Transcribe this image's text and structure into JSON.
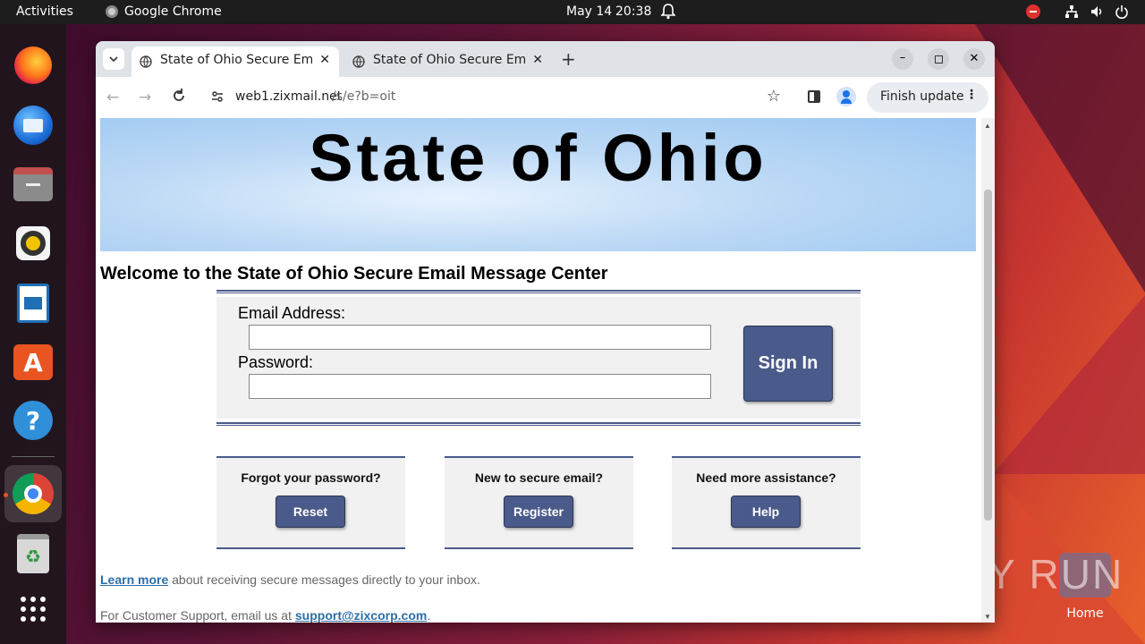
{
  "topbar": {
    "activities": "Activities",
    "app_name": "Google Chrome",
    "date": "May 14",
    "time": "20:38"
  },
  "dock": {
    "items": [
      "firefox-icon",
      "thunderbird-icon",
      "files-icon",
      "rhythmbox-icon",
      "libreoffice-writer-icon",
      "app-center-icon",
      "help-icon",
      "chrome-icon",
      "trash-icon",
      "show-apps-icon"
    ]
  },
  "desktop": {
    "home_label": "Home",
    "watermark": "ANY RUN"
  },
  "browser": {
    "tabs": [
      {
        "title": "State of Ohio Secure Em"
      },
      {
        "title": "State of Ohio Secure Em"
      }
    ],
    "url_host": "web1.zixmail.net",
    "url_path": "/s/e?b=oit",
    "finish_update": "Finish update"
  },
  "page": {
    "banner_title": "State of Ohio",
    "heading": "Welcome to the State of Ohio Secure Email Message Center",
    "email_label": "Email Address:",
    "email_value": "",
    "password_label": "Password:",
    "password_value": "",
    "sign_in": "Sign In",
    "boxes": [
      {
        "question": "Forgot your password?",
        "button": "Reset"
      },
      {
        "question": "New to secure email?",
        "button": "Register"
      },
      {
        "question": "Need more assistance?",
        "button": "Help"
      }
    ],
    "learn_more_link": "Learn more",
    "learn_more_text": " about receiving secure messages directly to your inbox.",
    "support_text": "For Customer Support, email us at ",
    "support_link": "support@zixcorp.com",
    "support_end": "."
  },
  "colors": {
    "accent_button": "#4a5a8a",
    "link": "#2c6ea6"
  }
}
